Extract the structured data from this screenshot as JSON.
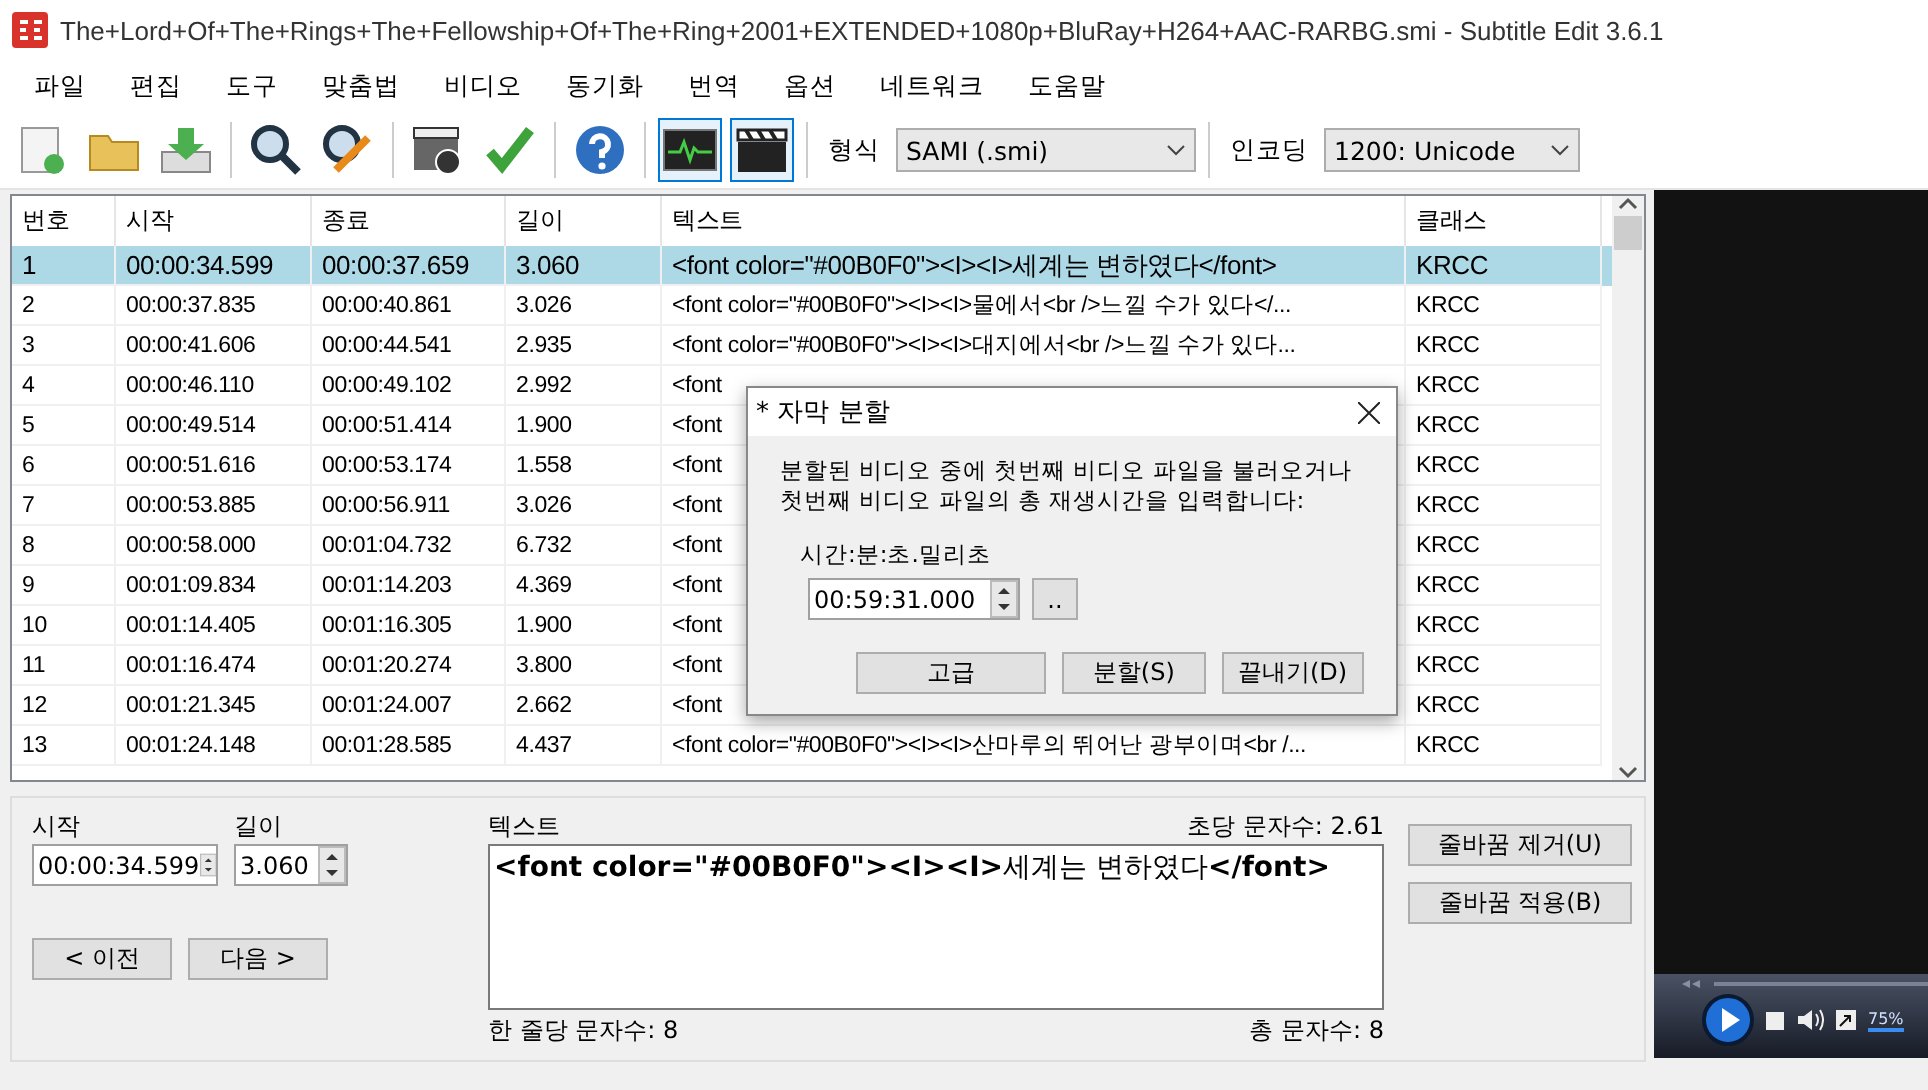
{
  "window": {
    "title": "The+Lord+Of+The+Rings+The+Fellowship+Of+The+Ring+2001+EXTENDED+1080p+BluRay+H264+AAC-RARBG.smi - Subtitle Edit 3.6.1"
  },
  "menu": [
    "파일",
    "편집",
    "도구",
    "맞춤법",
    "비디오",
    "동기화",
    "번역",
    "옵션",
    "네트워크",
    "도움말"
  ],
  "toolbar": [
    [
      {
        "kind": "new",
        "selected": false
      },
      {
        "kind": "open",
        "selected": false
      },
      {
        "kind": "download",
        "selected": false
      }
    ],
    [
      {
        "kind": "find",
        "selected": false
      },
      {
        "kind": "replace",
        "selected": false
      }
    ],
    [
      {
        "kind": "video",
        "selected": false
      },
      {
        "kind": "check",
        "selected": false
      }
    ],
    [
      {
        "kind": "help",
        "selected": false
      }
    ],
    [
      {
        "kind": "wave",
        "selected": true
      },
      {
        "kind": "clapper",
        "selected": true
      }
    ]
  ],
  "format": {
    "label": "형식",
    "value": "SAMI (.smi)"
  },
  "encoding": {
    "label": "인코딩",
    "value": "1200: Unicode"
  },
  "table": {
    "columns": [
      "번호",
      "시작",
      "종료",
      "길이",
      "텍스트",
      "클래스"
    ],
    "rows": [
      {
        "cells": [
          "1",
          "00:00:34.599",
          "00:00:37.659",
          "3.060",
          "<font color=\"#00B0F0\"><I><I>세계는 변하였다</font>",
          "KRCC"
        ],
        "selected": true
      },
      {
        "cells": [
          "2",
          "00:00:37.835",
          "00:00:40.861",
          "3.026",
          "<font color=\"#00B0F0\"><I><I>물에서<br />느낄 수가 있다</...",
          "KRCC"
        ],
        "selected": false
      },
      {
        "cells": [
          "3",
          "00:00:41.606",
          "00:00:44.541",
          "2.935",
          "<font color=\"#00B0F0\"><I><I>대지에서<br />느낄 수가 있다...",
          "KRCC"
        ],
        "selected": false
      },
      {
        "cells": [
          "4",
          "00:00:46.110",
          "00:00:49.102",
          "2.992",
          "<font",
          "KRCC"
        ],
        "selected": false
      },
      {
        "cells": [
          "5",
          "00:00:49.514",
          "00:00:51.414",
          "1.900",
          "<font",
          "KRCC"
        ],
        "selected": false
      },
      {
        "cells": [
          "6",
          "00:00:51.616",
          "00:00:53.174",
          "1.558",
          "<font",
          "KRCC"
        ],
        "selected": false
      },
      {
        "cells": [
          "7",
          "00:00:53.885",
          "00:00:56.911",
          "3.026",
          "<font",
          "KRCC"
        ],
        "selected": false
      },
      {
        "cells": [
          "8",
          "00:00:58.000",
          "00:01:04.732",
          "6.732",
          "<font",
          "KRCC"
        ],
        "selected": false
      },
      {
        "cells": [
          "9",
          "00:01:09.834",
          "00:01:14.203",
          "4.369",
          "<font",
          "KRCC"
        ],
        "selected": false
      },
      {
        "cells": [
          "10",
          "00:01:14.405",
          "00:01:16.305",
          "1.900",
          "<font",
          "KRCC"
        ],
        "selected": false
      },
      {
        "cells": [
          "11",
          "00:01:16.474",
          "00:01:20.274",
          "3.800",
          "<font",
          "KRCC"
        ],
        "selected": false
      },
      {
        "cells": [
          "12",
          "00:01:21.345",
          "00:01:24.007",
          "2.662",
          "<font",
          "KRCC"
        ],
        "selected": false
      },
      {
        "cells": [
          "13",
          "00:01:24.148",
          "00:01:28.585",
          "4.437",
          "<font color=\"#00B0F0\"><I><I>산마루의 뛰어난 광부이며<br /...",
          "KRCC"
        ],
        "selected": false
      }
    ]
  },
  "editor": {
    "start_label": "시작",
    "start_value": "00:00:34.599",
    "duration_label": "길이",
    "duration_value": "3.060",
    "prev_button": "< 이전",
    "next_button": "다음 >",
    "text_label": "텍스트",
    "chars_per_sec": "초당 문자수: 2.61",
    "text": "**<font color=\"#00B0F0\"><I><I>**세계는 변하였다**</font>**",
    "line_length": "한 줄당 문자수: 8",
    "total_chars": "총 문자수: 8",
    "buttons": [
      "줄바꿈 제거(U)",
      "줄바꿈 적용(B)"
    ]
  },
  "video": {
    "volume": "75%"
  },
  "dialog": {
    "title": "* 자막 분할",
    "message": [
      "분할된 비디오 중에 첫번째 비디오 파일을 불러오거나",
      "첫번째 비디오 파일의 총 재생시간을 입력합니다:"
    ],
    "field_label": "시간:분:초.밀리초",
    "field_value": "00:59:31.000",
    "browse_button": "..",
    "buttons": [
      "고급",
      "분할(S)",
      "끝내기(D)"
    ]
  }
}
